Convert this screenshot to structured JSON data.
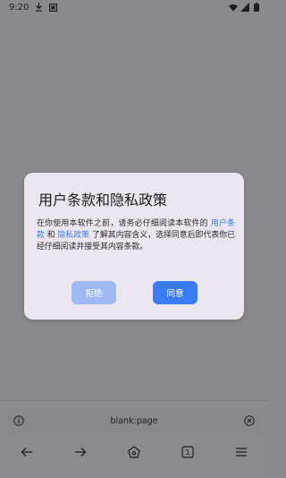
{
  "status_bar": {
    "time": "9:20",
    "left_icons": [
      "download-icon",
      "notification-icon"
    ],
    "right_icons": [
      "wifi-icon",
      "signal-icon",
      "battery-icon"
    ]
  },
  "dialog": {
    "title": "用户条款和隐私政策",
    "body_part1": "在你使用本软件之前，请务必仔细阅读本软件的 ",
    "link_terms": "用户条款",
    "body_and": " 和 ",
    "link_privacy": "隐私政策",
    "body_part2": " 了解其内容含义，选择同意后即代表你已经仔细阅读并接受其内容条款。",
    "reject_label": "拒绝",
    "agree_label": "同意"
  },
  "address_bar": {
    "url": "blank:page",
    "left_icon": "info-icon",
    "right_icon": "clear-icon"
  },
  "bottom_nav": {
    "items": [
      "back-icon",
      "forward-icon",
      "home-icon",
      "tab-count-icon",
      "menu-icon"
    ],
    "tab_count": "1"
  },
  "colors": {
    "overlay": "#8a898e",
    "dialog_bg": "#ece6f0",
    "accent": "#3a7cf5",
    "reject_bg": "#9fb9f4"
  }
}
